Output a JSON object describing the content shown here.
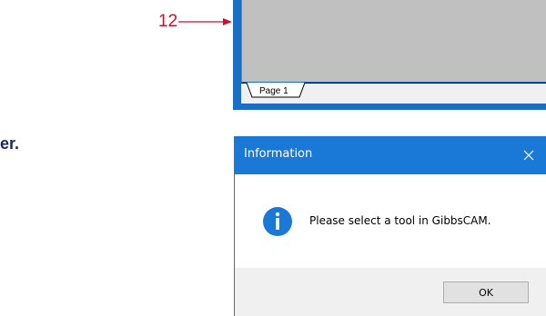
{
  "callout": {
    "number": "12"
  },
  "partial_text": "er.",
  "top_window": {
    "page_tab_label": "Page 1"
  },
  "dialog": {
    "title": "Information",
    "close_icon": "close-icon",
    "message": "Please select a tool in GibbsCAM.",
    "info_icon": "info-icon",
    "ok_label": "OK"
  },
  "colors": {
    "accent": "#1a78d6",
    "callout": "#c8102e",
    "canvas": "#c0c0c0",
    "footer": "#f0f0f0"
  }
}
